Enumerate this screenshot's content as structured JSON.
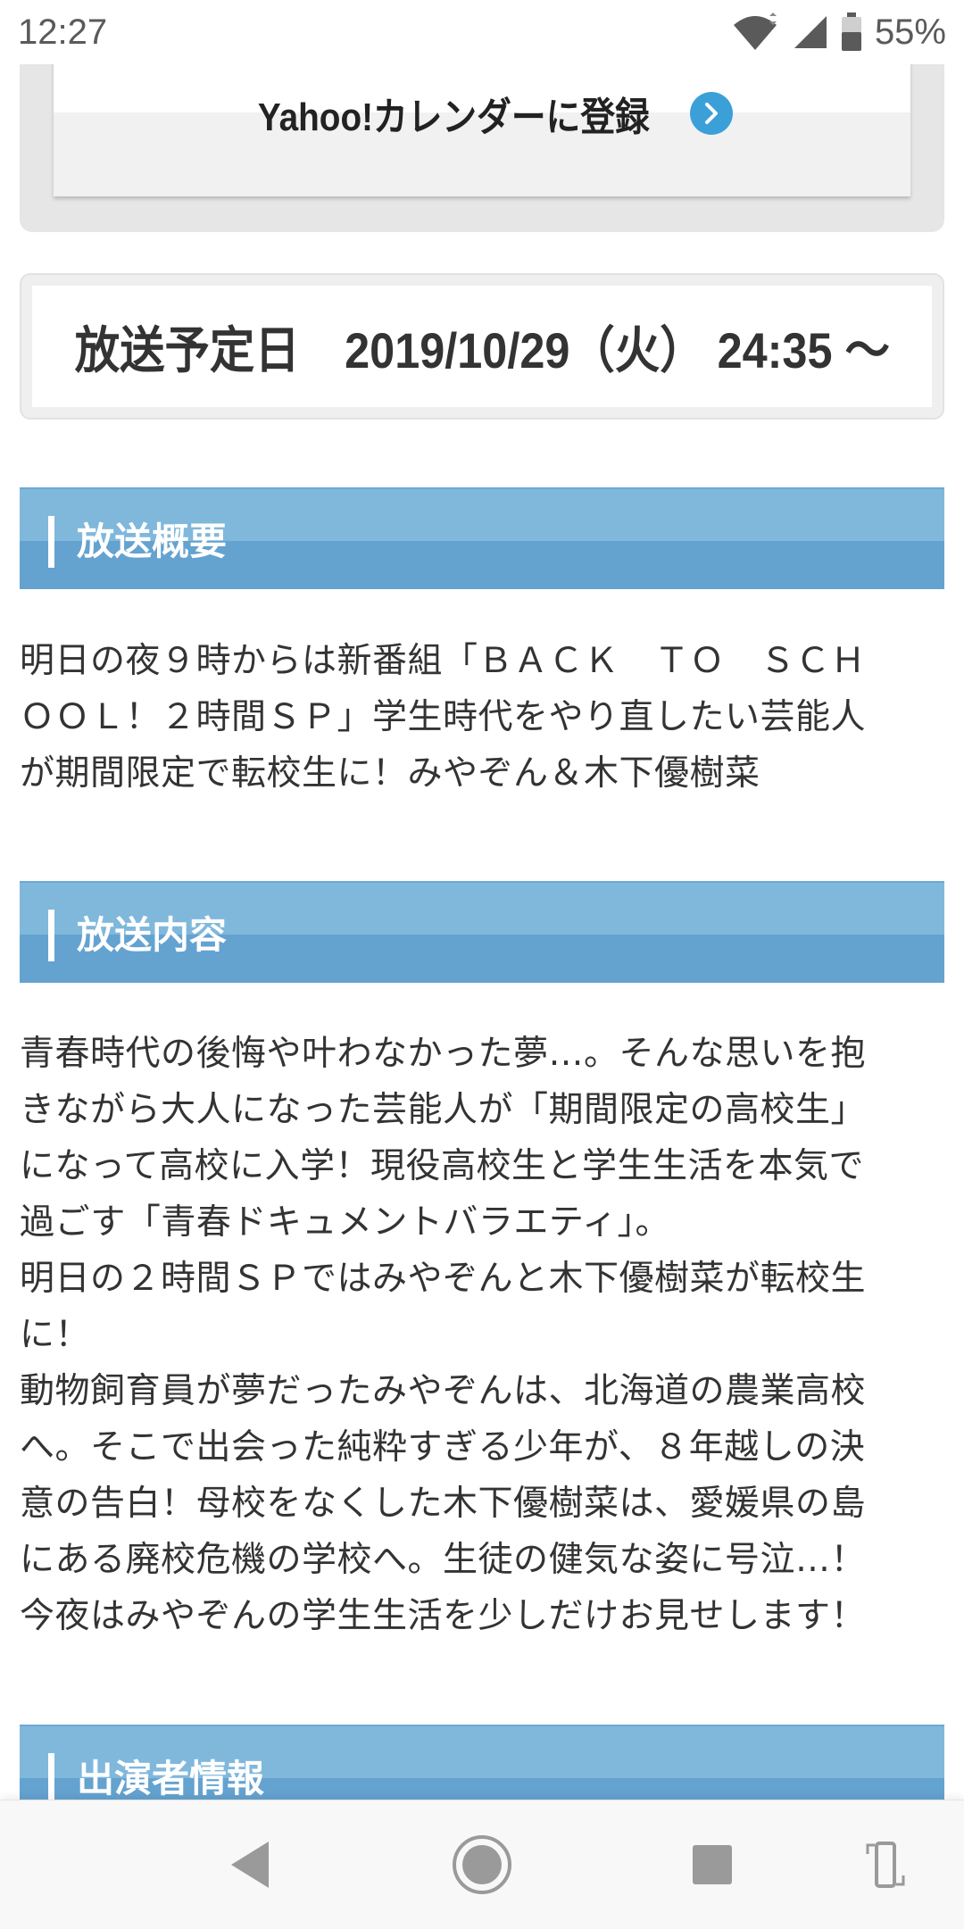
{
  "status_bar": {
    "time": "12:27",
    "battery_percent": "55%"
  },
  "calendar": {
    "label": "Yahoo!カレンダーに登録"
  },
  "broadcast_date": {
    "text": "放送予定日　2019/10/29（火） 24:35 〜"
  },
  "sections": {
    "overview": {
      "title": "放送概要",
      "body": "明日の夜９時からは新番組「ＢＡＣＫ　ＴＯ　ＳＣＨ\nＯＯＬ！２時間ＳＰ」学生時代をやり直したい芸能人\nが期間限定で転校生に！みやぞん＆木下優樹菜"
    },
    "content": {
      "title": "放送内容",
      "body": "青春時代の後悔や叶わなかった夢…。そんな思いを抱\nきながら大人になった芸能人が「期間限定の高校生」\nになって高校に入学！現役高校生と学生生活を本気で\n過ごす「青春ドキュメントバラエティ」。\n明日の２時間ＳＰではみやぞんと木下優樹菜が転校生\nに！\n動物飼育員が夢だったみやぞんは、北海道の農業高校\nへ。そこで出会った純粋すぎる少年が、８年越しの決\n意の告白！母校をなくした木下優樹菜は、愛媛県の島\nにある廃校危機の学校へ。生徒の健気な姿に号泣…！\n今夜はみやぞんの学生生活を少しだけお見せします！"
    },
    "cast": {
      "title": "出演者情報"
    }
  },
  "icons": {
    "wifi": "wifi-icon",
    "signal": "signal-icon",
    "battery": "battery-icon",
    "arrow": "chevron-right-circle-icon",
    "back": "back-triangle-icon",
    "home": "home-circle-icon",
    "recents": "recents-square-icon",
    "rotate": "rotate-icon"
  },
  "colors": {
    "section_header_light": "#80b8dc",
    "section_header_dark": "#64a2d0",
    "accent_arrow": "#3ca0d8"
  }
}
